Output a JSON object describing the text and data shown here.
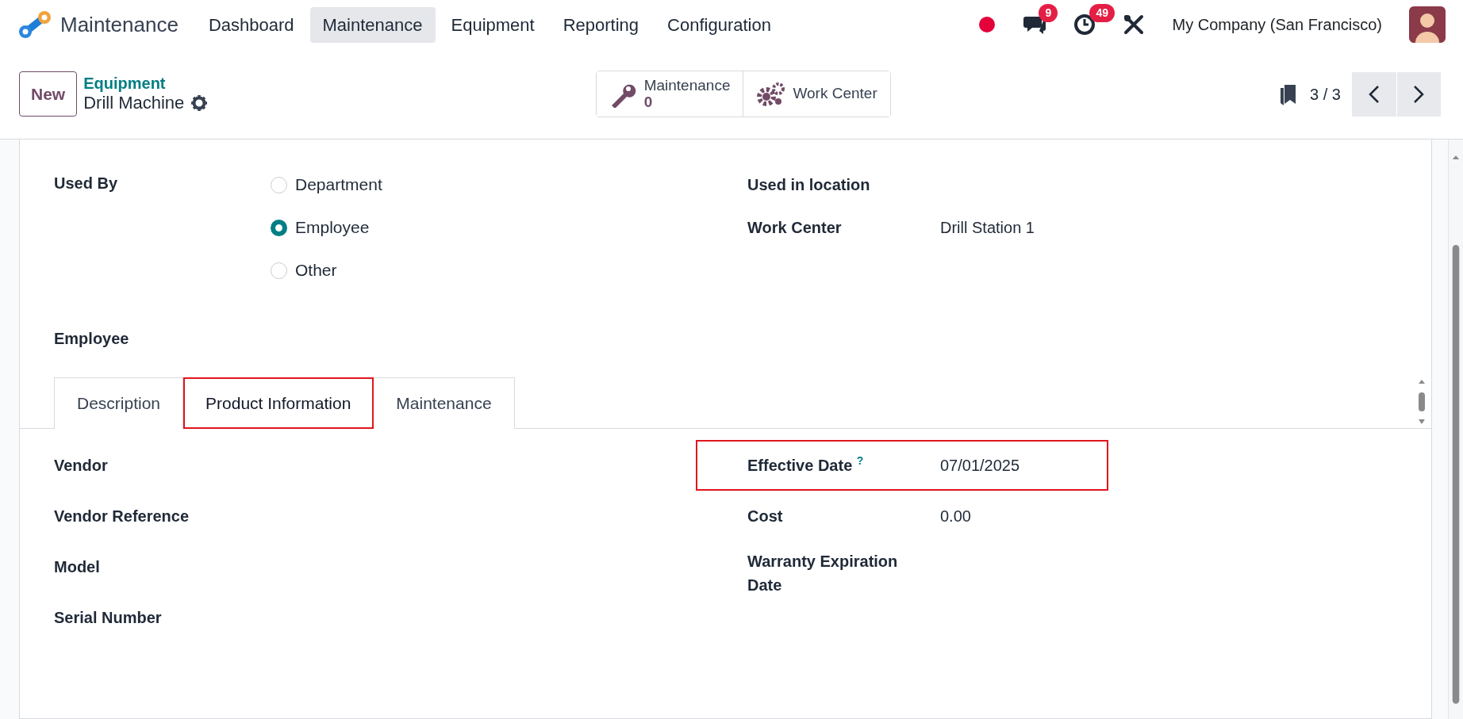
{
  "app": {
    "name": "Maintenance"
  },
  "menu": [
    {
      "label": "Dashboard",
      "selected": false
    },
    {
      "label": "Maintenance",
      "selected": true
    },
    {
      "label": "Equipment",
      "selected": false
    },
    {
      "label": "Reporting",
      "selected": false
    },
    {
      "label": "Configuration",
      "selected": false
    }
  ],
  "systray": {
    "chat_count": "9",
    "activity_count": "49",
    "company": "My Company (San Francisco)"
  },
  "new_button": "New",
  "breadcrumb": {
    "parent": "Equipment",
    "current": "Drill Machine"
  },
  "stat_buttons": [
    {
      "kind": "counter",
      "label": "Maintenance",
      "value": "0"
    },
    {
      "kind": "plain",
      "label": "Work Center"
    }
  ],
  "pager": {
    "value": "3 / 3"
  },
  "used_by": {
    "label": "Used By",
    "options": [
      {
        "label": "Department",
        "selected": false
      },
      {
        "label": "Employee",
        "selected": true
      },
      {
        "label": "Other",
        "selected": false
      }
    ]
  },
  "right_fields": [
    {
      "label": "Used in location"
    },
    {
      "label": "Work Center",
      "value": "Drill Station 1"
    }
  ],
  "employee": {
    "label": "Employee"
  },
  "tabs": [
    {
      "label": "Description",
      "selected": false,
      "highlighted": false
    },
    {
      "label": "Product Information",
      "selected": true,
      "highlighted": true
    },
    {
      "label": "Maintenance",
      "selected": false,
      "highlighted": false
    }
  ],
  "tab_left_fields": [
    {
      "label": "Vendor"
    },
    {
      "label": "Vendor Reference"
    },
    {
      "label": "Model"
    },
    {
      "label": "Serial Number"
    }
  ],
  "tab_right_fields": [
    {
      "label": "Effective Date",
      "help": "?",
      "value": "07/01/2025",
      "highlighted": true
    },
    {
      "label": "Cost",
      "value": "0.00",
      "highlighted": false
    },
    {
      "label": "Warranty Expiration Date",
      "highlighted": false
    }
  ]
}
